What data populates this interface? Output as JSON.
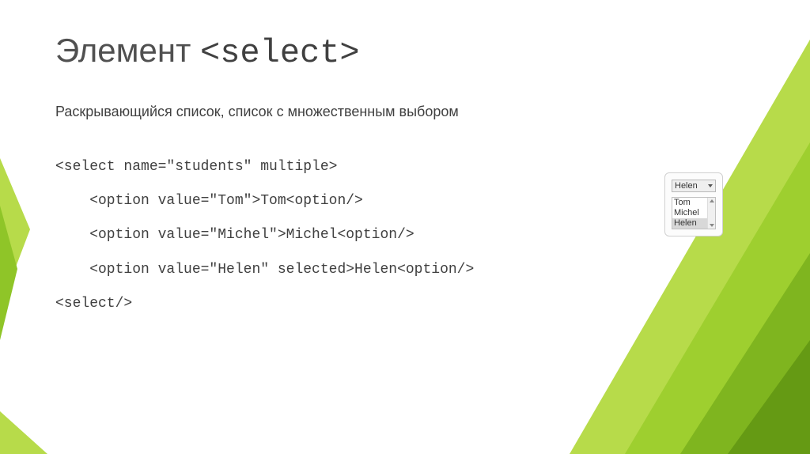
{
  "title": {
    "word": "Элемент ",
    "tag": "<select>"
  },
  "subtitle": "Раскрывающийся список, список с множественным выбором",
  "code": {
    "l1": "<select name=\"students\" multiple>",
    "l2": "    <option value=\"Tom\">Tom<option/>",
    "l3": "    <option value=\"Michel\">Michel<option/>",
    "l4": "    <option value=\"Helen\" selected>Helen<option/>",
    "l5": "<select/>"
  },
  "preview": {
    "dropdown_selected": "Helen",
    "options": [
      "Tom",
      "Michel",
      "Helen"
    ],
    "list_selected_index": 2
  },
  "colors": {
    "green_light": "#b7db4a",
    "green_mid": "#9ecf2f",
    "green_dark": "#7fb51f",
    "green_deep": "#659a14"
  }
}
